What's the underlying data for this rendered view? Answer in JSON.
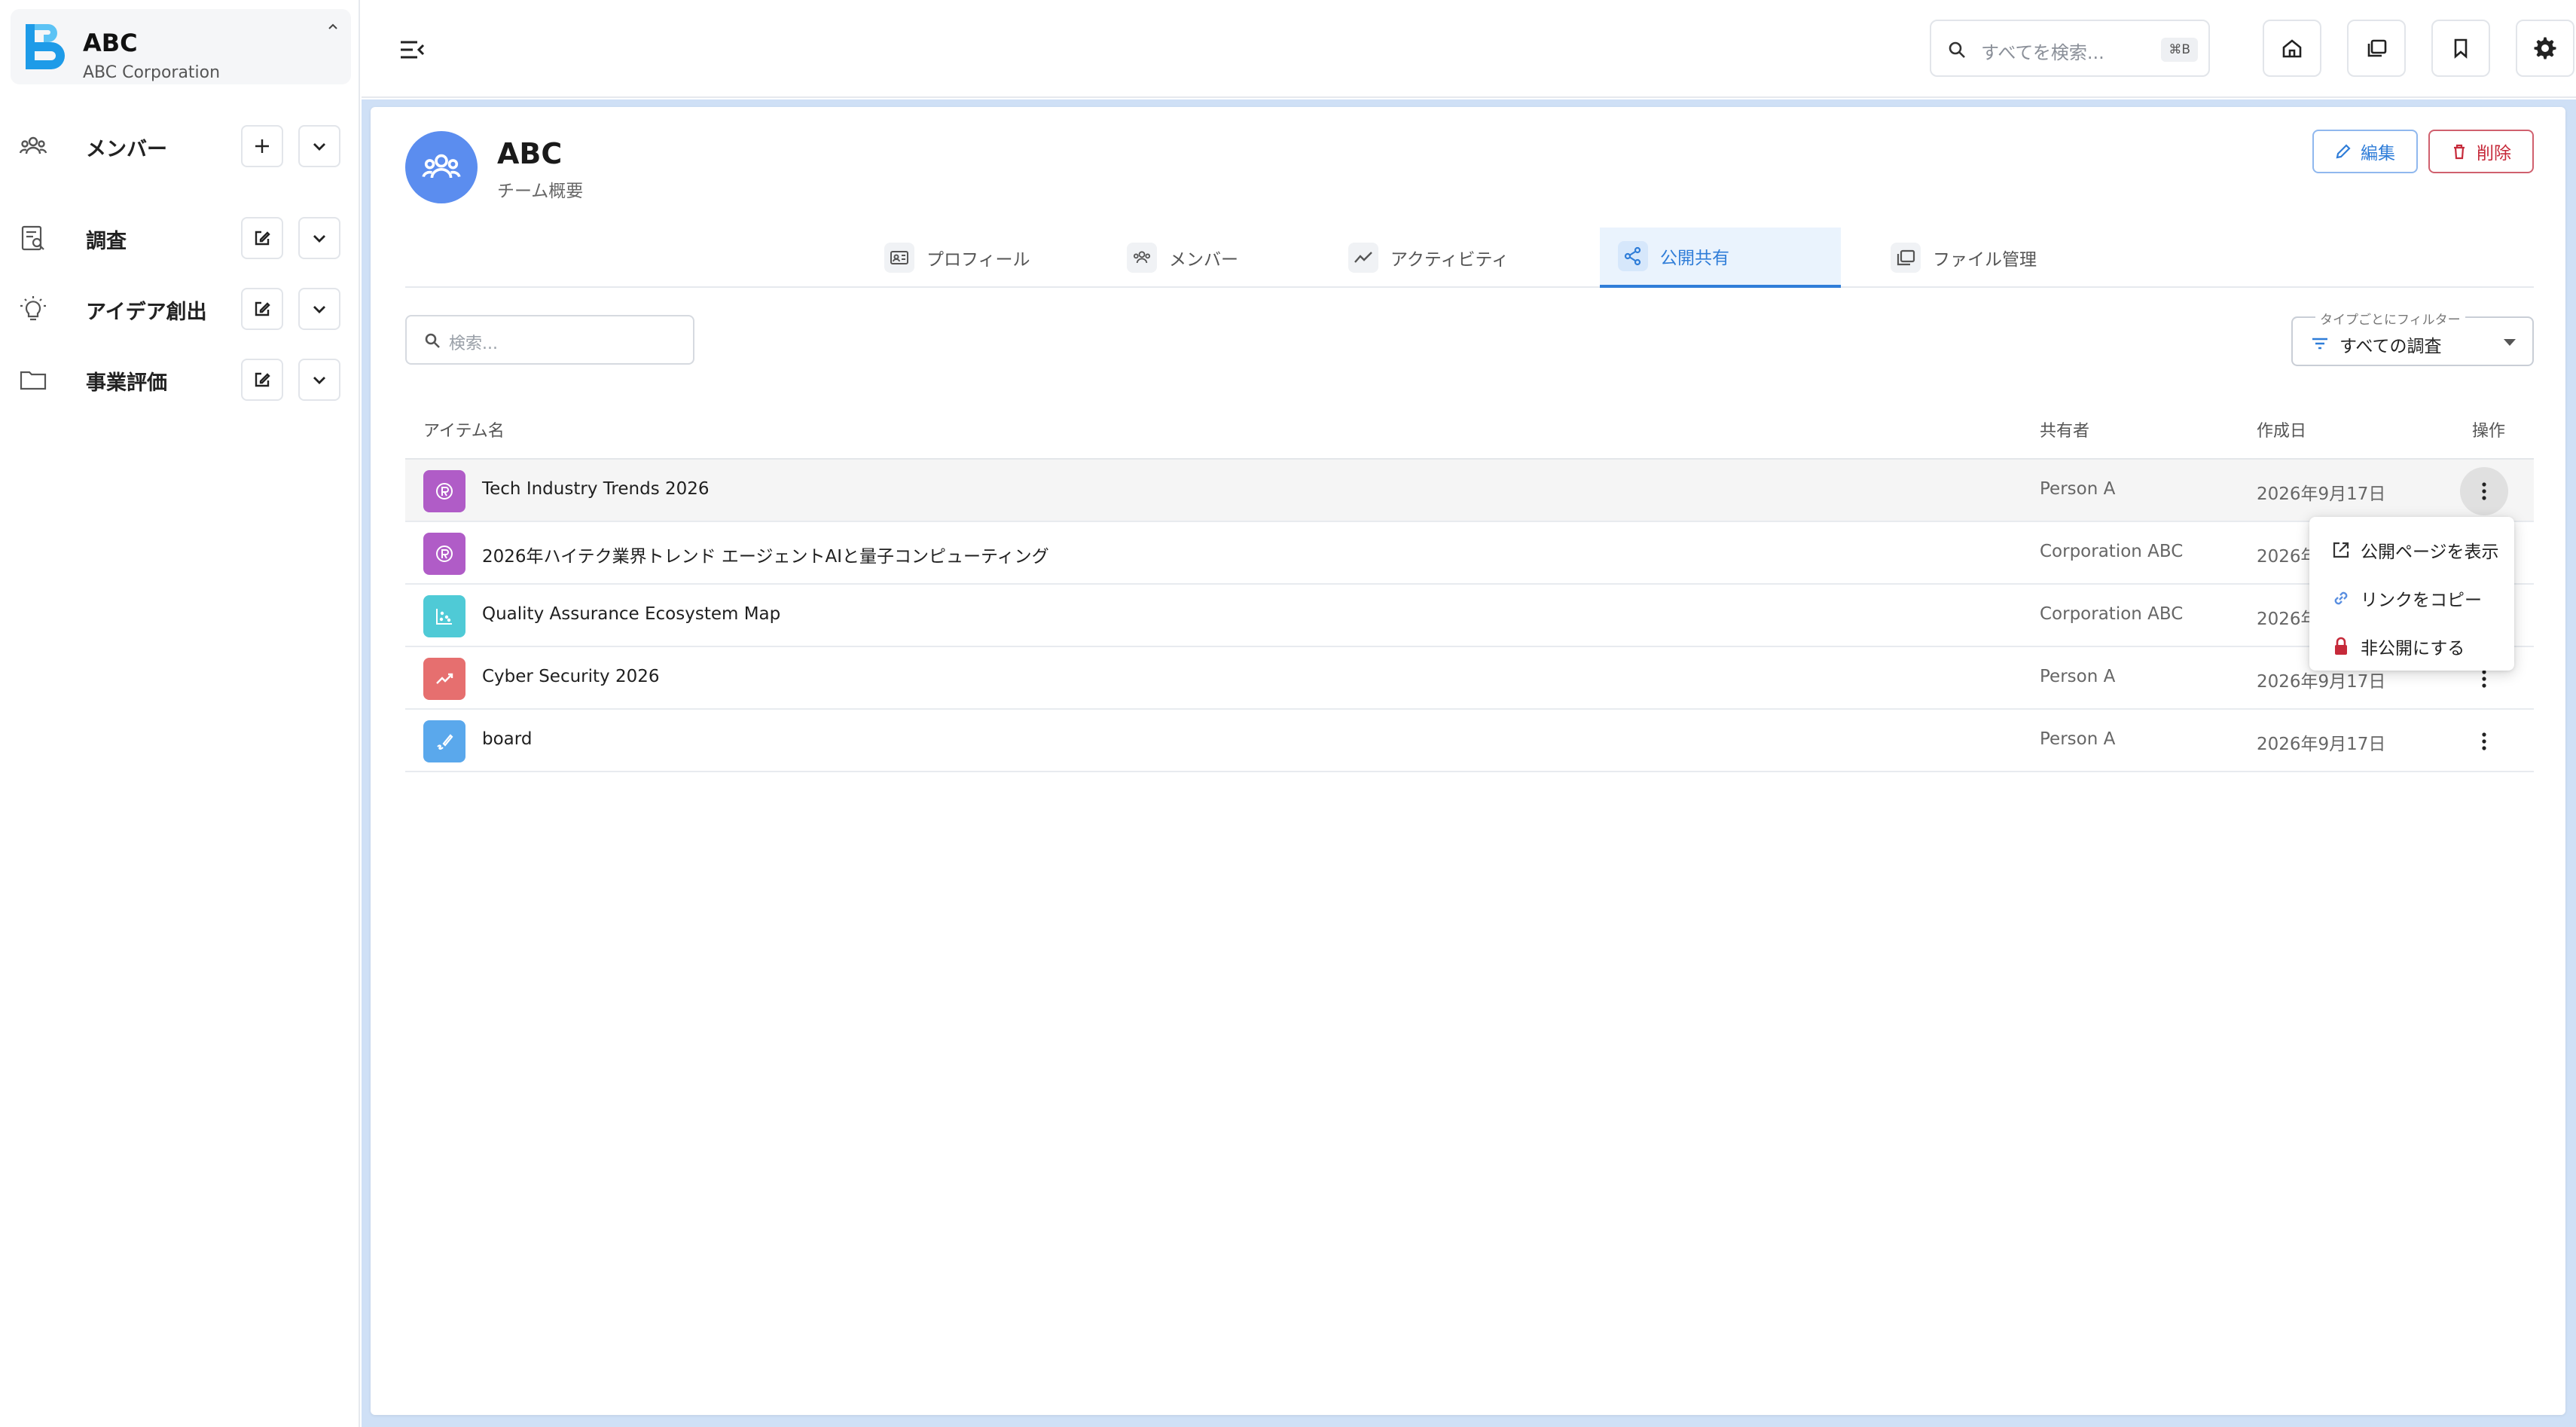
{
  "org": {
    "name": "ABC",
    "subtitle": "ABC Corporation"
  },
  "sidebar": {
    "items": [
      {
        "label": "メンバー",
        "icon": "group-icon",
        "action_icon": "plus-icon"
      },
      {
        "label": "調査",
        "icon": "search-document-icon",
        "action_icon": "edit-icon"
      },
      {
        "label": "アイデア創出",
        "icon": "lightbulb-icon",
        "action_icon": "edit-icon"
      },
      {
        "label": "事業評価",
        "icon": "folder-icon",
        "action_icon": "edit-icon"
      }
    ]
  },
  "topbar": {
    "search_placeholder": "すべてを検索...",
    "shortcut": "⌘B",
    "buttons": [
      "home-icon",
      "collections-icon",
      "bookmark-icon",
      "settings-icon"
    ]
  },
  "team": {
    "title": "ABC",
    "subtitle": "チーム概要"
  },
  "actions": {
    "edit_label": "編集",
    "delete_label": "削除"
  },
  "tabs": [
    {
      "label": "プロフィール",
      "icon": "profile-card-icon"
    },
    {
      "label": "メンバー",
      "icon": "group-icon"
    },
    {
      "label": "アクティビティ",
      "icon": "activity-icon"
    },
    {
      "label": "公開共有",
      "icon": "share-icon",
      "active": true
    },
    {
      "label": "ファイル管理",
      "icon": "files-icon"
    }
  ],
  "list_search": {
    "placeholder": "検索..."
  },
  "filter": {
    "legend": "タイプごとにフィルター",
    "value": "すべての調査"
  },
  "table": {
    "headers": {
      "name": "アイテム名",
      "sharer": "共有者",
      "date": "作成日",
      "actions": "操作"
    },
    "rows": [
      {
        "name": "Tech Industry Trends 2026",
        "sharer": "Person A",
        "date": "2026年9月17日",
        "icon": "report-icon",
        "color": "#b05cc7"
      },
      {
        "name": "2026年ハイテク業界トレンド エージェントAIと量子コンピューティング",
        "sharer": "Corporation ABC",
        "date": "2026年9月17日",
        "icon": "report-icon",
        "color": "#b05cc7"
      },
      {
        "name": "Quality Assurance Ecosystem Map",
        "sharer": "Corporation ABC",
        "date": "2026年9月17日",
        "icon": "scatter-chart-icon",
        "color": "#4fcad6"
      },
      {
        "name": "Cyber Security 2026",
        "sharer": "Person A",
        "date": "2026年9月17日",
        "icon": "trend-icon",
        "color": "#e66f6f"
      },
      {
        "name": "board",
        "sharer": "Person A",
        "date": "2026年9月17日",
        "icon": "draw-icon",
        "color": "#5aa8ec"
      }
    ]
  },
  "context_menu": {
    "items": [
      {
        "label": "公開ページを表示",
        "icon": "open-external-icon"
      },
      {
        "label": "リンクをコピー",
        "icon": "link-icon"
      },
      {
        "label": "非公開にする",
        "icon": "lock-icon"
      }
    ]
  }
}
